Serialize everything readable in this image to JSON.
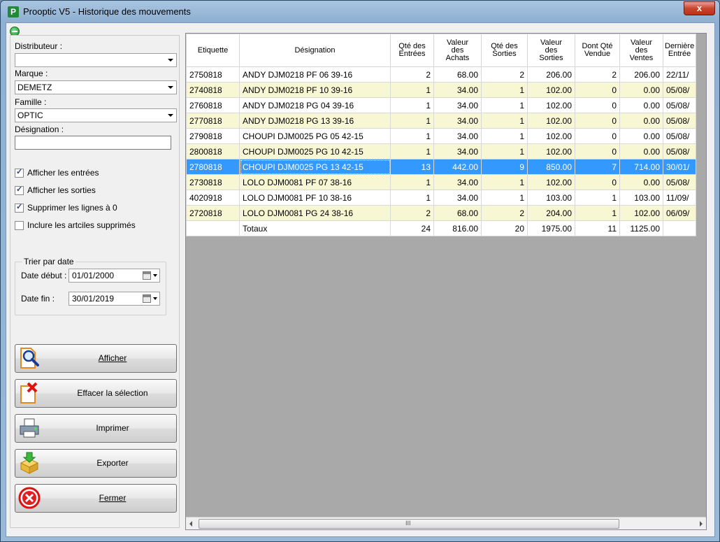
{
  "window": {
    "title": "Prooptic V5 - Historique des mouvements",
    "close_label": "x"
  },
  "filters": {
    "distributeur": {
      "label": "Distributeur :",
      "value": ""
    },
    "marque": {
      "label": "Marque :",
      "value": "DEMETZ"
    },
    "famille": {
      "label": "Famille :",
      "value": "OPTIC"
    },
    "designation": {
      "label": "Désignation :",
      "value": ""
    }
  },
  "checkboxes": [
    {
      "label": "Afficher les entrées",
      "checked": true
    },
    {
      "label": "Afficher les sorties",
      "checked": true
    },
    {
      "label": "Supprimer les lignes à 0",
      "checked": true
    },
    {
      "label": "Inclure les artciles supprimés",
      "checked": false
    }
  ],
  "date_group": {
    "title": "Trier par date",
    "start_label": "Date début :",
    "start_value": "01/01/2000",
    "end_label": "Date fin :",
    "end_value": "30/01/2019"
  },
  "buttons": {
    "afficher": "Afficher",
    "effacer": "Effacer la sélection",
    "imprimer": "Imprimer",
    "exporter": "Exporter",
    "fermer": "Fermer"
  },
  "icons": {
    "collapse": "green-minus-icon",
    "afficher": "magnifier-document-icon",
    "effacer": "red-x-document-icon",
    "imprimer": "printer-icon",
    "exporter": "export-box-icon",
    "fermer": "red-close-circle-icon"
  },
  "grid": {
    "columns": [
      "Etiquette",
      "Désignation",
      "Qté des\nEntrées",
      "Valeur\ndes\nAchats",
      "Qté des\nSorties",
      "Valeur\ndes\nSorties",
      "Dont Qté\nVendue",
      "Valeur\ndes\nVentes",
      "Dernière\nEntrée"
    ],
    "rows": [
      [
        "2750818",
        "ANDY DJM0218 PF 06 39-16",
        "2",
        "68.00",
        "2",
        "206.00",
        "2",
        "206.00",
        "22/11/"
      ],
      [
        "2740818",
        "ANDY DJM0218 PF 10 39-16",
        "1",
        "34.00",
        "1",
        "102.00",
        "0",
        "0.00",
        "05/08/"
      ],
      [
        "2760818",
        "ANDY DJM0218 PG 04 39-16",
        "1",
        "34.00",
        "1",
        "102.00",
        "0",
        "0.00",
        "05/08/"
      ],
      [
        "2770818",
        "ANDY DJM0218 PG 13 39-16",
        "1",
        "34.00",
        "1",
        "102.00",
        "0",
        "0.00",
        "05/08/"
      ],
      [
        "2790818",
        "CHOUPI DJM0025 PG 05 42-15",
        "1",
        "34.00",
        "1",
        "102.00",
        "0",
        "0.00",
        "05/08/"
      ],
      [
        "2800818",
        "CHOUPI DJM0025 PG 10 42-15",
        "1",
        "34.00",
        "1",
        "102.00",
        "0",
        "0.00",
        "05/08/"
      ],
      [
        "2780818",
        "CHOUPI DJM0025 PG 13 42-15",
        "13",
        "442.00",
        "9",
        "850.00",
        "7",
        "714.00",
        "30/01/"
      ],
      [
        "2730818",
        "LOLO DJM0081 PF 07 38-16",
        "1",
        "34.00",
        "1",
        "102.00",
        "0",
        "0.00",
        "05/08/"
      ],
      [
        "4020918",
        "LOLO DJM0081 PF 10 38-16",
        "1",
        "34.00",
        "1",
        "103.00",
        "1",
        "103.00",
        "11/09/"
      ],
      [
        "2720818",
        "LOLO DJM0081 PG 24 38-16",
        "2",
        "68.00",
        "2",
        "204.00",
        "1",
        "102.00",
        "06/09/"
      ]
    ],
    "totals": [
      "",
      "Totaux",
      "24",
      "816.00",
      "20",
      "1975.00",
      "11",
      "1125.00",
      ""
    ],
    "selected_row": 6,
    "scroll_grip": "III"
  },
  "colors": {
    "selection": "#3399ff",
    "alt_row": "#f8f7d4"
  }
}
